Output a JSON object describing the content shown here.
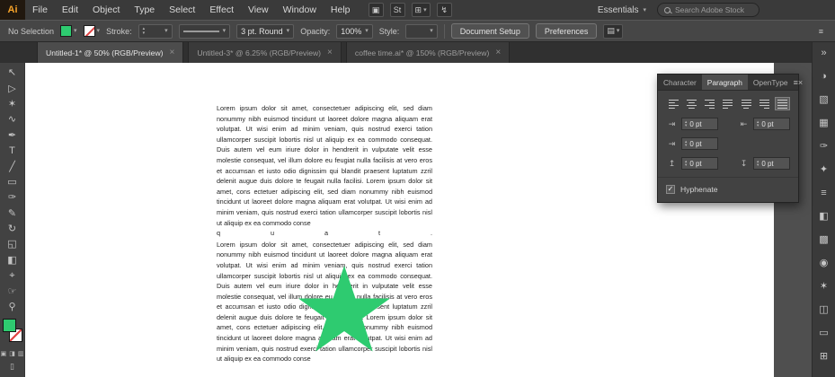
{
  "colors": {
    "fill_green": "#2ecb70",
    "star": "#2ecb70"
  },
  "glyphs": {
    "chevron_down": "▾",
    "up": "▴",
    "down": "▾"
  },
  "menu_bar": {
    "logo": "Ai",
    "menus": [
      "File",
      "Edit",
      "Object",
      "Type",
      "Select",
      "Effect",
      "View",
      "Window",
      "Help"
    ],
    "icons": [
      {
        "name": "adobe-bridge-icon",
        "glyph": "▣"
      },
      {
        "name": "adobe-stock-icon",
        "glyph": "St"
      },
      {
        "name": "arrange-documents-icon",
        "glyph": "⊞"
      },
      {
        "name": "gpu-performance-icon",
        "glyph": "↯"
      }
    ],
    "workspace": "Essentials",
    "search_placeholder": "Search Adobe Stock"
  },
  "control_bar": {
    "selection_status": "No Selection",
    "stroke_label": "Stroke:",
    "brush_definition": "3 pt. Round",
    "opacity_label": "Opacity:",
    "opacity_value": "100%",
    "style_label": "Style:",
    "document_setup": "Document Setup",
    "preferences": "Preferences",
    "options_icon": "▤",
    "menu_icon": "≡"
  },
  "document_tabs": [
    {
      "title": "Untitled-1* @ 50% (RGB/Preview)",
      "close": "×"
    },
    {
      "title": "Untitled-3* @ 6.25% (RGB/Preview)",
      "close": "×"
    },
    {
      "title": "coffee time.ai* @ 150% (RGB/Preview)",
      "close": "×"
    }
  ],
  "toolbar": {
    "tools": [
      {
        "name": "selection-tool",
        "glyph": "↖"
      },
      {
        "name": "direct-selection-tool",
        "glyph": "▷"
      },
      {
        "name": "magic-wand-tool",
        "glyph": "✶"
      },
      {
        "name": "lasso-tool",
        "glyph": "∿"
      },
      {
        "name": "pen-tool",
        "glyph": "✒"
      },
      {
        "name": "type-tool",
        "glyph": "T"
      },
      {
        "name": "line-segment-tool",
        "glyph": "╱"
      },
      {
        "name": "rectangle-tool",
        "glyph": "▭"
      },
      {
        "name": "paintbrush-tool",
        "glyph": "✑"
      },
      {
        "name": "pencil-tool",
        "glyph": "✎"
      },
      {
        "name": "rotate-tool",
        "glyph": "↻"
      },
      {
        "name": "scale-tool",
        "glyph": "◱"
      },
      {
        "name": "gradient-tool",
        "glyph": "◧"
      },
      {
        "name": "eyedropper-tool",
        "glyph": "⌖"
      },
      {
        "name": "hand-tool",
        "glyph": "☞"
      },
      {
        "name": "zoom-tool",
        "glyph": "⚲"
      }
    ],
    "draw_modes": [
      "▣",
      "◨",
      "▥"
    ],
    "screen_mode": "▯"
  },
  "canvas": {
    "paragraph_1": "Lorem ipsum dolor sit amet, consectetuer adipiscing elit, sed diam nonummy nibh euismod tincidunt ut laoreet dolore magna aliquam erat volutpat. Ut wisi enim ad minim veniam, quis nostrud exerci tation ullamcorper suscipit lobortis nisl ut aliquip ex ea commodo consequat. Duis autem vel eum iriure dolor in hendrerit in vulputate velit esse molestie consequat, vel illum dolore eu feugiat nulla facilisis at vero eros et accumsan et iusto odio dignissim qui blandit praesent luptatum zzril delenit augue duis dolore te feugait nulla facilisi. Lorem ipsum dolor sit amet, cons ectetuer adipiscing elit, sed diam nonummy nibh euismod tincidunt ut laoreet dolore magna aliquam erat volutpat. Ut wisi enim ad minim veniam, quis nostrud exerci tation ullamcorper suscipit lobortis nisl ut aliquip ex ea commodo conse",
    "paragraph_1_last_line": "q u a t .",
    "paragraph_2": "Lorem ipsum dolor sit amet, consectetuer adipiscing elit, sed diam nonummy nibh euismod tincidunt ut laoreet dolore magna aliquam erat volutpat. Ut wisi enim ad minim veniam, quis nostrud exerci tation ullamcorper suscipit lobortis nisl ut aliquip ex ea commodo consequat. Duis autem vel eum iriure dolor in hendrerit in vulputate velit esse molestie consequat, vel illum dolore eu feugiat nulla facilisis at vero eros et accumsan et iusto odio dignissim qui blandit praesent luptatum zzril delenit augue duis dolore te feugait nulla facilisi. Lorem ipsum dolor sit amet, cons ectetuer adipiscing elit, sed diam nonummy nibh euismod tincidunt ut laoreet dolore magna aliquam erat volutpat. Ut wisi enim ad minim veniam, quis nostrud exerci tation ullamcorper suscipit lobortis nisl ut aliquip ex ea commodo conse"
  },
  "paragraph_panel": {
    "tabs": [
      "Character",
      "Paragraph",
      "OpenType"
    ],
    "menu_glyph": "≡",
    "close_glyph": "×",
    "icons": {
      "left_indent": "⇥",
      "right_indent": "⇤",
      "first_line_indent": "⇥",
      "space_before": "↥",
      "space_after": "↧"
    },
    "left_indent": "0 pt",
    "right_indent": "0 pt",
    "first_line_indent": "0 pt",
    "space_before": "0 pt",
    "space_after": "0 pt",
    "hyphenate": "Hyphenate",
    "check_glyph": "✓"
  },
  "side_dock": {
    "top_icons": [
      {
        "name": "expand-panels-icon",
        "glyph": "«"
      },
      {
        "name": "properties-panel-icon",
        "glyph": "▤"
      },
      {
        "name": "libraries-panel-icon",
        "glyph": "▣"
      }
    ],
    "icons": [
      {
        "name": "collapse-dock-icon",
        "glyph": "»"
      },
      {
        "name": "color-panel-icon",
        "glyph": "◑"
      },
      {
        "name": "color-guide-panel-icon",
        "glyph": "▧"
      },
      {
        "name": "swatches-panel-icon",
        "glyph": "▦"
      },
      {
        "name": "brushes-panel-icon",
        "glyph": "✑"
      },
      {
        "name": "symbols-panel-icon",
        "glyph": "✦"
      },
      {
        "name": "stroke-panel-icon",
        "glyph": "≡"
      },
      {
        "name": "gradient-panel-icon",
        "glyph": "◧"
      },
      {
        "name": "transparency-panel-icon",
        "glyph": "▩"
      },
      {
        "name": "appearance-panel-icon",
        "glyph": "◉"
      },
      {
        "name": "graphic-styles-panel-icon",
        "glyph": "✶"
      },
      {
        "name": "layers-panel-icon",
        "glyph": "◫"
      },
      {
        "name": "artboards-panel-icon",
        "glyph": "▭"
      },
      {
        "name": "align-panel-icon",
        "glyph": "⊞"
      }
    ]
  }
}
